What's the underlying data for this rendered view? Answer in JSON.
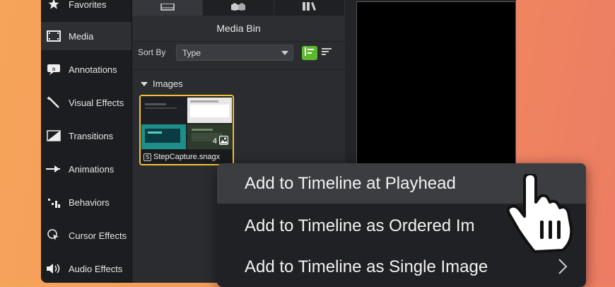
{
  "sidebar": {
    "items": [
      {
        "label": "Favorites",
        "icon": "star-icon"
      },
      {
        "label": "Media",
        "icon": "film-icon"
      },
      {
        "label": "Annotations",
        "icon": "annotation-icon"
      },
      {
        "label": "Visual Effects",
        "icon": "magic-wand-icon"
      },
      {
        "label": "Transitions",
        "icon": "transition-icon"
      },
      {
        "label": "Animations",
        "icon": "animation-icon"
      },
      {
        "label": "Behaviors",
        "icon": "behaviors-icon"
      },
      {
        "label": "Cursor Effects",
        "icon": "cursor-icon"
      },
      {
        "label": "Audio Effects",
        "icon": "speaker-icon"
      }
    ],
    "active_index": 1
  },
  "media_bin": {
    "title": "Media Bin",
    "tabs": [
      "film-tab-icon",
      "library-tab-icon",
      "books-tab-icon"
    ],
    "sort_label": "Sort By",
    "sort_value": "Type",
    "group_label": "Images",
    "item": {
      "caption": "StepCapture.snagx",
      "count": "4"
    }
  },
  "context_menu": {
    "items": [
      "Add to Timeline at Playhead",
      "Add to Timeline as Ordered Im",
      "Add to Timeline as Single Image"
    ],
    "highlighted_index": 0
  },
  "colors": {
    "accent_green": "#5cb82e",
    "selection_yellow": "#f0c23a"
  }
}
